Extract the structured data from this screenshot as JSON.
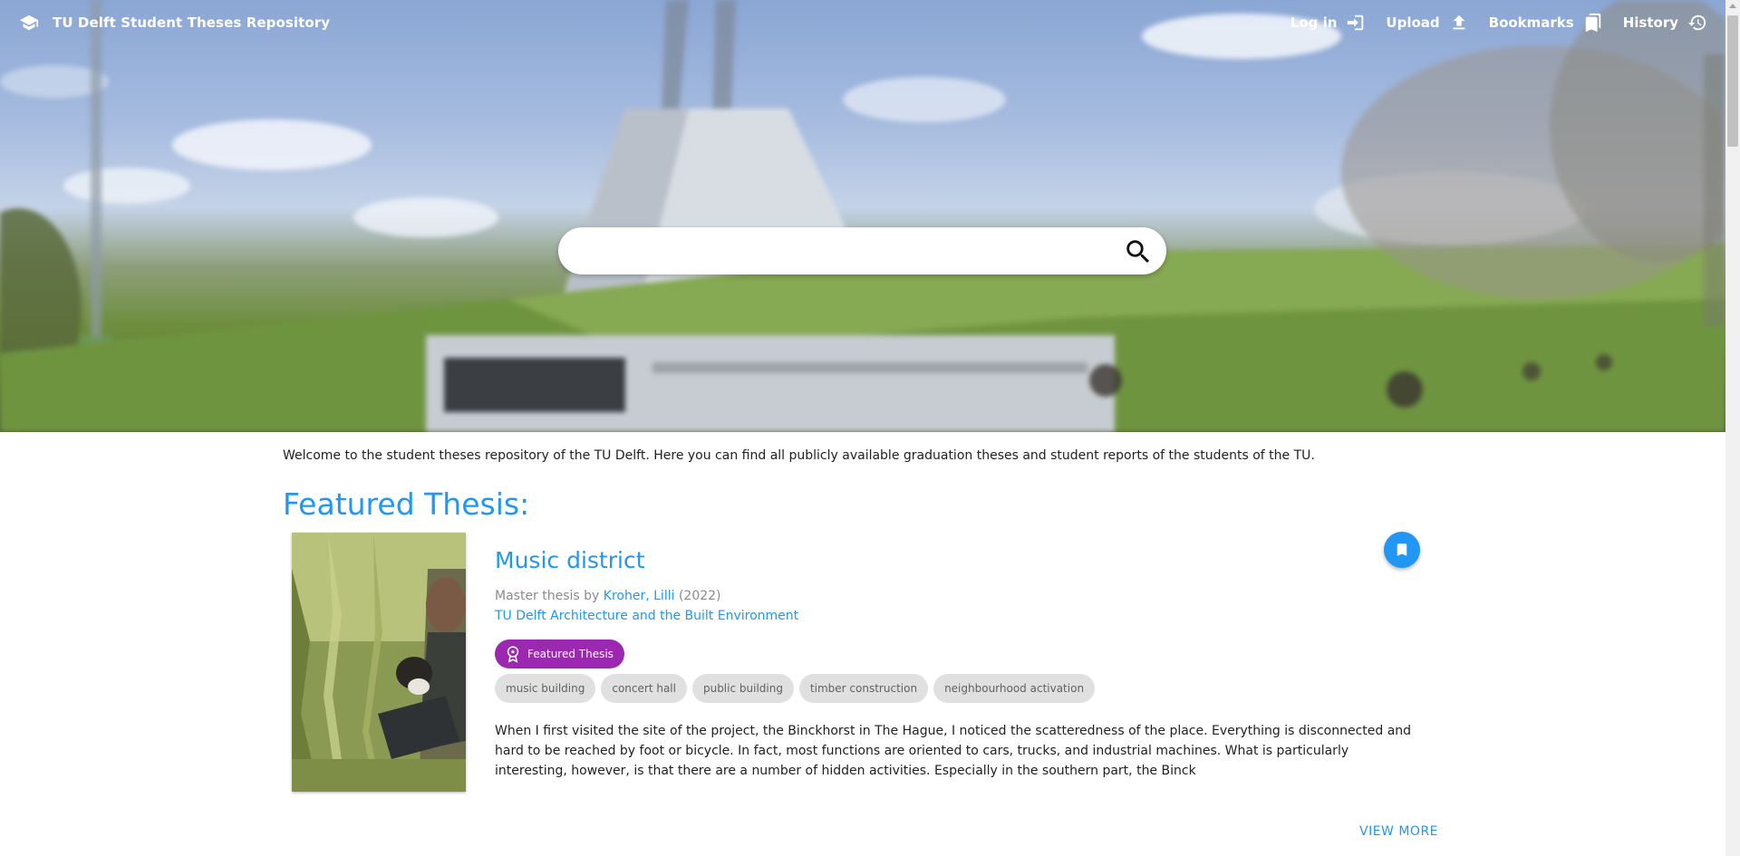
{
  "header": {
    "title": "TU Delft Student Theses Repository",
    "logo_icon": "graduation-cap-icon",
    "nav": [
      {
        "label": "Log in",
        "icon": "login-icon"
      },
      {
        "label": "Upload",
        "icon": "upload-icon"
      },
      {
        "label": "Bookmarks",
        "icon": "bookmarks-icon"
      },
      {
        "label": "History",
        "icon": "history-icon"
      }
    ]
  },
  "search": {
    "value": "",
    "placeholder": "",
    "icon": "search-icon"
  },
  "welcome_text": "Welcome to the student theses repository of the TU Delft. Here you can find all publicly available graduation theses and student reports of the students of the TU.",
  "featured": {
    "section_title": "Featured Thesis:",
    "title": "Music district",
    "meta_prefix": "Master thesis by",
    "author": "Kroher, Lilli",
    "year": "(2022)",
    "faculty": "TU Delft Architecture and the Built Environment",
    "badge": "Featured Thesis",
    "tags": [
      "music building",
      "concert hall",
      "public building",
      "timber construction",
      "neighbourhood activation"
    ],
    "abstract": "When I first visited the site of the project, the Binckhorst in The Hague, I noticed the scatteredness of the place. Everything is disconnected and hard to be reached by foot or bicycle. In fact, most functions are oriented to cars, trucks, and industrial machines. What is particularly interesting, however, is that there are a number of hidden activities. Especially in the southern part, the Binck",
    "view_more": "VIEW MORE"
  },
  "colors": {
    "accent": "#2196f3",
    "featured_badge": "#9c27b0",
    "tag_bg": "#e0e0e0"
  }
}
